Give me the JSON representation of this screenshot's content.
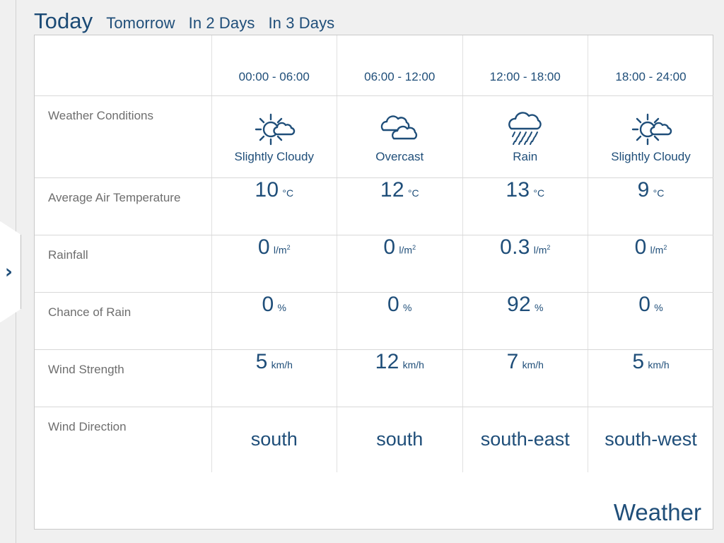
{
  "flyout": {
    "icon": "chevron-right-icon",
    "glyph": "›"
  },
  "tabs": [
    {
      "label": "Today",
      "active": true
    },
    {
      "label": "Tomorrow",
      "active": false
    },
    {
      "label": "In 2 Days",
      "active": false
    },
    {
      "label": "In 3 Days",
      "active": false
    }
  ],
  "table": {
    "time_slots": [
      "00:00 - 06:00",
      "06:00 - 12:00",
      "12:00 - 18:00",
      "18:00 - 24:00"
    ],
    "rows": {
      "conditions": {
        "label": "Weather Conditions",
        "values": [
          {
            "icon": "sun-behind-cloud-icon",
            "label": "Slightly Cloudy"
          },
          {
            "icon": "overcast-clouds-icon",
            "label": "Overcast"
          },
          {
            "icon": "rain-cloud-icon",
            "label": "Rain"
          },
          {
            "icon": "sun-behind-cloud-icon",
            "label": "Slightly Cloudy"
          }
        ]
      },
      "temperature": {
        "label": "Average Air Temperature",
        "unit": "°C",
        "values": [
          "10",
          "12",
          "13",
          "9"
        ]
      },
      "rainfall": {
        "label": "Rainfall",
        "unit": "l/m",
        "unit_sup": "2",
        "values": [
          "0",
          "0",
          "0.3",
          "0"
        ]
      },
      "chance_of_rain": {
        "label": "Chance of Rain",
        "unit": "%",
        "values": [
          "0",
          "0",
          "92",
          "0"
        ]
      },
      "wind_strength": {
        "label": "Wind Strength",
        "unit": "km/h",
        "values": [
          "5",
          "12",
          "7",
          "5"
        ]
      },
      "wind_direction": {
        "label": "Wind Direction",
        "values": [
          "south",
          "south",
          "south-east",
          "south-west"
        ]
      }
    }
  },
  "footer": {
    "title": "Weather"
  },
  "colors": {
    "accent_blue": "#1f4e79",
    "label_gray": "#6e6e6e",
    "grid_line": "#d8d8d8",
    "page_background": "#f0f0f0"
  }
}
